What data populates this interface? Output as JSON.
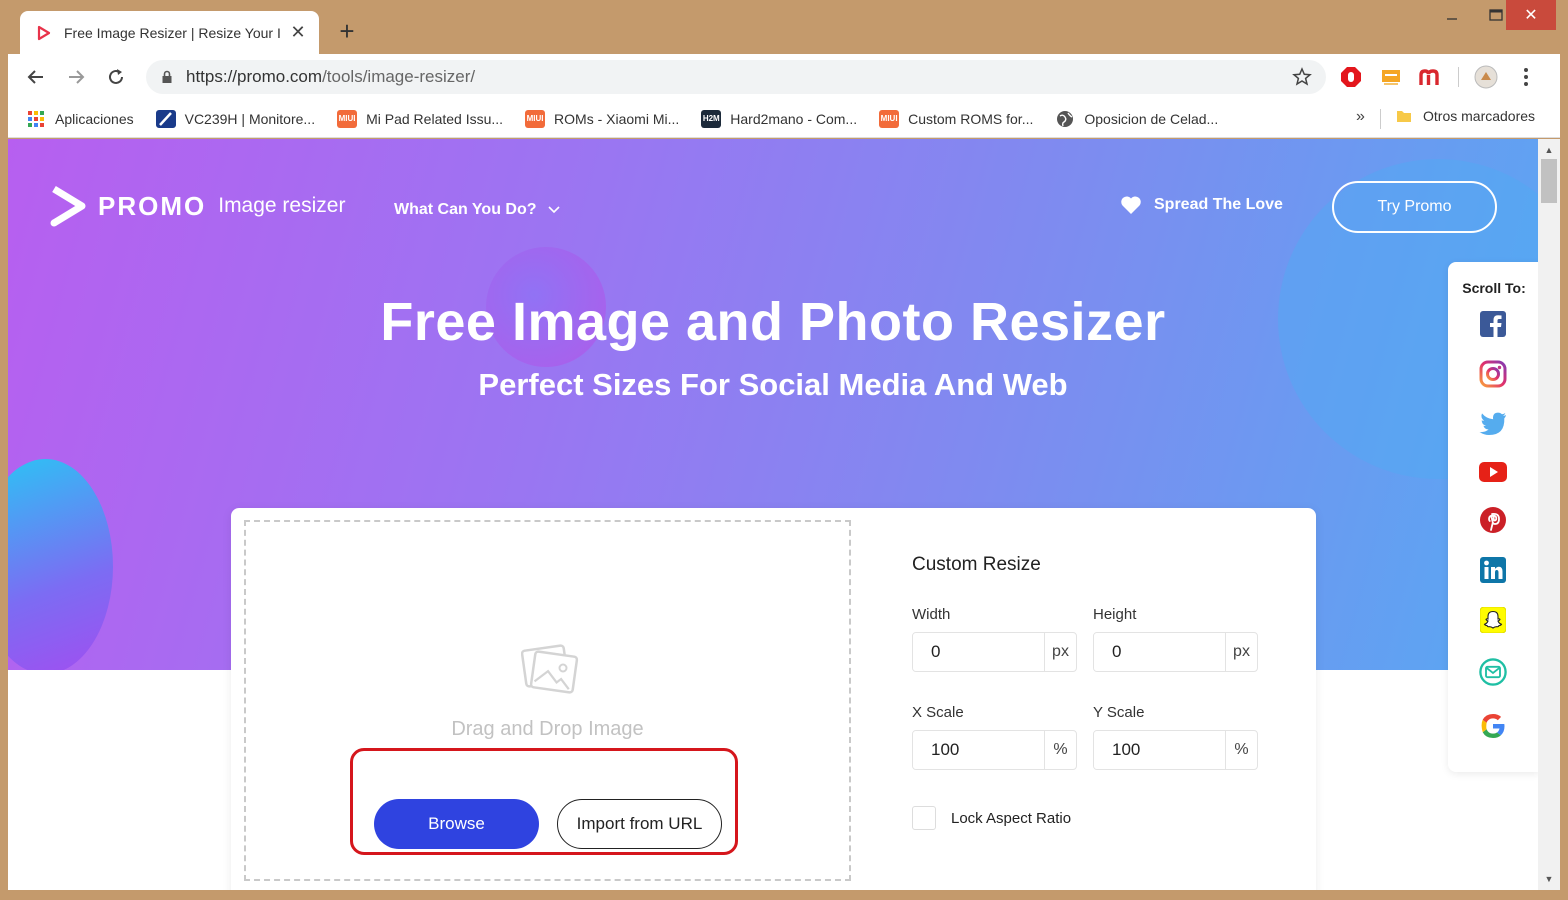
{
  "browser": {
    "tab_title": "Free Image Resizer | Resize Your I",
    "url_host": "https://promo.com",
    "url_path": "/tools/image-resizer/",
    "bookmarks": [
      {
        "label": "Aplicaciones",
        "icon": "apps-grid-icon"
      },
      {
        "label": "VC239H | Monitore...",
        "icon": "asus-icon"
      },
      {
        "label": "Mi Pad Related Issu...",
        "icon": "miui-icon"
      },
      {
        "label": "ROMs - Xiaomi Mi...",
        "icon": "miui-icon"
      },
      {
        "label": "Hard2mano - Com...",
        "icon": "h2m-icon"
      },
      {
        "label": "Custom ROMS for...",
        "icon": "miui-icon"
      },
      {
        "label": "Oposicion de Celad...",
        "icon": "globe-icon"
      }
    ],
    "bookmarks_more": "»",
    "other_bookmarks": "Otros marcadores",
    "miui_badge": "MIUI",
    "h2m_badge": "H2M"
  },
  "header": {
    "logo_word": "PROMO",
    "logo_sub": "Image resizer",
    "nav_what": "What Can You Do?",
    "spread": "Spread The Love",
    "try": "Try Promo"
  },
  "hero": {
    "title": "Free Image and Photo Resizer",
    "subtitle": "Perfect Sizes For Social Media And Web"
  },
  "upload": {
    "drop_text": "Drag and Drop Image",
    "browse": "Browse",
    "import": "Import from URL"
  },
  "resize": {
    "title": "Custom Resize",
    "width_label": "Width",
    "width_value": "0",
    "width_unit": "px",
    "height_label": "Height",
    "height_value": "0",
    "height_unit": "px",
    "xscale_label": "X Scale",
    "xscale_value": "100",
    "xscale_unit": "%",
    "yscale_label": "Y Scale",
    "yscale_value": "100",
    "yscale_unit": "%",
    "lock_label": "Lock Aspect Ratio"
  },
  "scroll_to": {
    "title": "Scroll To:",
    "items": [
      "facebook-icon",
      "instagram-icon",
      "twitter-icon",
      "youtube-icon",
      "pinterest-icon",
      "linkedin-icon",
      "snapchat-icon",
      "email-icon",
      "google-icon"
    ]
  },
  "colors": {
    "browse": "#2f43e0",
    "highlight": "#d5161c",
    "hero_start": "#b75ff0",
    "hero_end": "#58a8f2"
  }
}
